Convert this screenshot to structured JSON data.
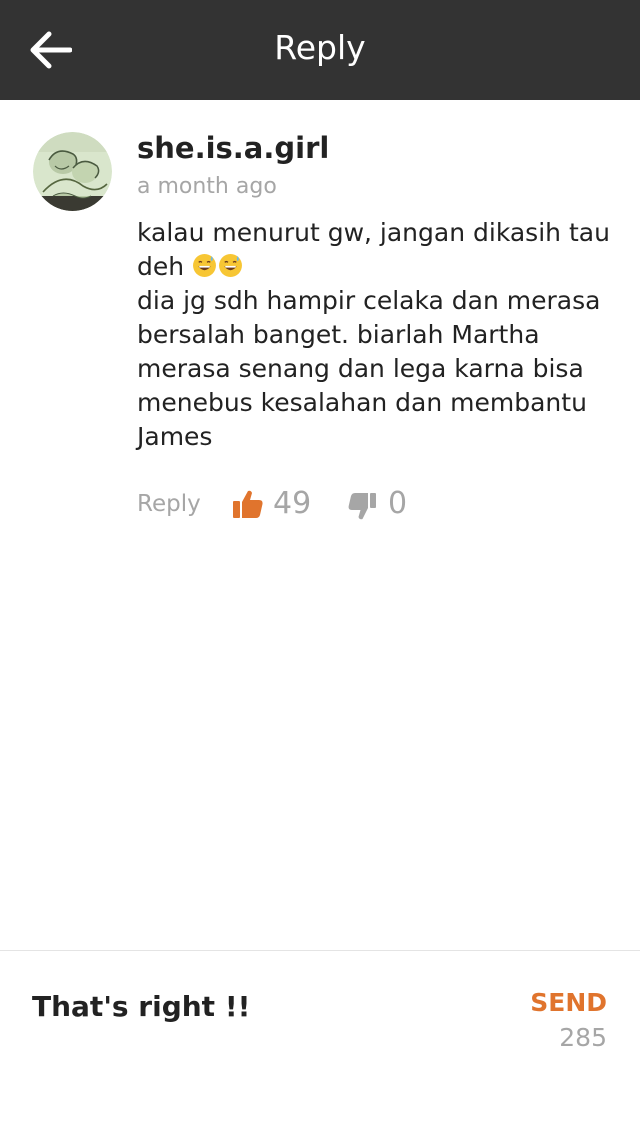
{
  "header": {
    "title": "Reply",
    "back_icon": "arrow-left-icon"
  },
  "comment": {
    "username": "she.is.a.girl",
    "timestamp": "a month ago",
    "avatar_icon": "user-avatar-drawing",
    "lines": [
      "kalau menurut gw, jangan dikasih tau deh",
      "dia jg sdh hampir celaka dan merasa bersalah banget. biarlah Martha merasa senang dan lega karna bisa menebus kesalahan dan membantu James"
    ],
    "emoji_icons": [
      "grinning-sweat-emoji",
      "grinning-sweat-emoji"
    ],
    "reply_label": "Reply",
    "like_icon": "thumbs-up-icon",
    "like_count": "49",
    "dislike_icon": "thumbs-down-icon",
    "dislike_count": "0"
  },
  "composer": {
    "input_value": "That's right !!",
    "send_label": "SEND",
    "char_remaining": "285"
  },
  "colors": {
    "header_bg": "#333333",
    "accent": "#e0742d",
    "muted": "#a6a6a6",
    "text": "#222222"
  }
}
